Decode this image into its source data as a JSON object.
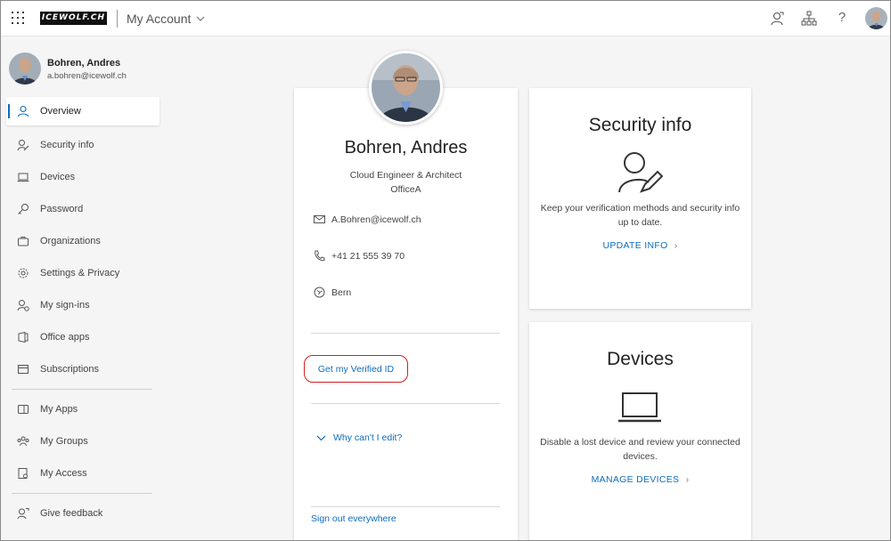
{
  "header": {
    "logo_text": "ICEWOLF.CH",
    "app_title": "My Account",
    "help_label": "?",
    "icons": [
      "waffle-icon",
      "feedback-icon",
      "org-chart-icon",
      "help-icon",
      "avatar"
    ]
  },
  "user": {
    "name": "Bohren, Andres",
    "email": "a.bohren@icewolf.ch"
  },
  "sidebar": {
    "items": [
      {
        "label": "Overview",
        "icon": "person-icon",
        "active": true
      },
      {
        "label": "Security info",
        "icon": "person-edit-icon"
      },
      {
        "label": "Devices",
        "icon": "laptop-icon"
      },
      {
        "label": "Password",
        "icon": "key-icon"
      },
      {
        "label": "Organizations",
        "icon": "briefcase-icon"
      },
      {
        "label": "Settings & Privacy",
        "icon": "gear-icon"
      },
      {
        "label": "My sign-ins",
        "icon": "person-sign-in-icon"
      },
      {
        "label": "Office apps",
        "icon": "office-icon"
      },
      {
        "label": "Subscriptions",
        "icon": "subscriptions-icon"
      }
    ],
    "group2": [
      {
        "label": "My Apps",
        "icon": "apps-icon"
      },
      {
        "label": "My Groups",
        "icon": "groups-icon"
      },
      {
        "label": "My Access",
        "icon": "access-icon"
      }
    ],
    "group3": [
      {
        "label": "Give feedback",
        "icon": "feedback-icon"
      }
    ]
  },
  "profile": {
    "name": "Bohren, Andres",
    "job_title": "Cloud Engineer & Architect",
    "office": "OfficeA",
    "email": "A.Bohren@icewolf.ch",
    "phone": "+41 21 555 39 70",
    "location": "Bern",
    "verified_id_link": "Get my Verified ID",
    "why_link": "Why can't I edit?",
    "signout_link": "Sign out everywhere"
  },
  "security_card": {
    "title": "Security info",
    "description": "Keep your verification methods and security info up to date.",
    "action": "UPDATE INFO",
    "icon": "person-edit-icon"
  },
  "devices_card": {
    "title": "Devices",
    "description": "Disable a lost device and review your connected devices.",
    "action": "MANAGE DEVICES",
    "icon": "laptop-icon"
  },
  "colors": {
    "accent": "#0f6cbd",
    "highlight_ring": "#d01f1f",
    "background": "#f5f5f5"
  }
}
